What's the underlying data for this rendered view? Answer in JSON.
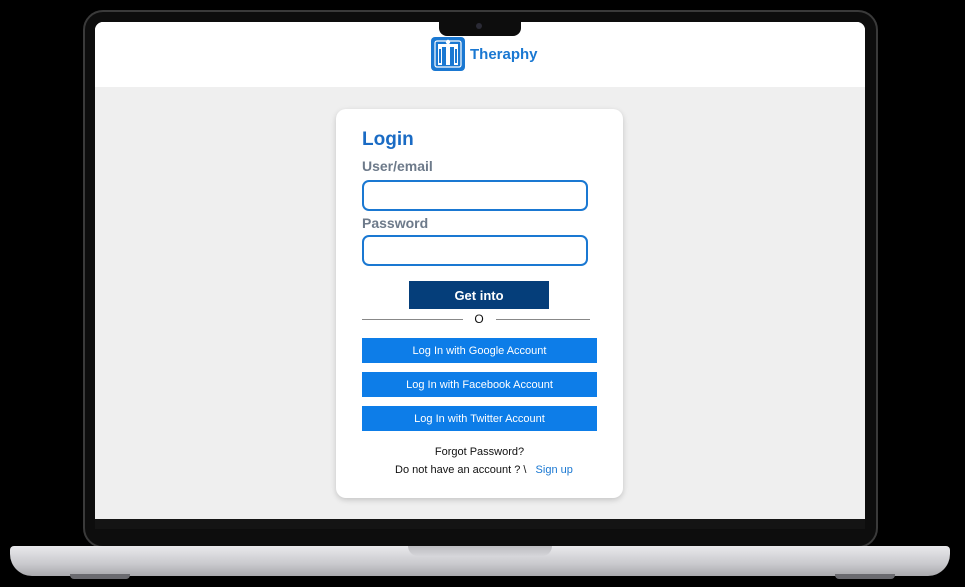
{
  "app": {
    "name": "Theraphy"
  },
  "login": {
    "title": "Login",
    "user_label": "User/email",
    "user_value": "",
    "password_label": "Password",
    "password_value": "",
    "submit_label": "Get into",
    "separator": "O",
    "google_label": "Log In with Google Account",
    "facebook_label": "Log In with Facebook Account",
    "twitter_label": "Log In with Twitter Account",
    "forgot_label": "Forgot Password?",
    "no_account_text": "Do not have an account ? \\",
    "signup_label": "Sign up"
  },
  "colors": {
    "brand": "#1a78d2",
    "primary_button": "#053e7a",
    "social_button": "#0d7de8",
    "page_background": "#efefef"
  },
  "icons": {
    "logo": "theraphy-logo-icon"
  }
}
